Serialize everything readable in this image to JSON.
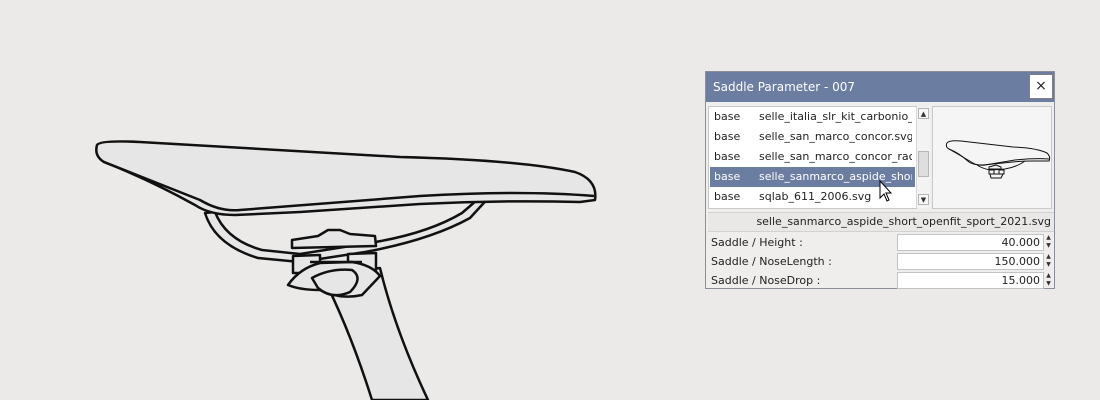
{
  "dialog": {
    "title": "Saddle Parameter - 007",
    "close_glyph": "×",
    "list_rows": [
      {
        "category": "base",
        "file": "selle_italia_slr_kit_carbonio_C"
      },
      {
        "category": "base",
        "file": "selle_san_marco_concor.svg"
      },
      {
        "category": "base",
        "file": "selle_san_marco_concor_raci"
      },
      {
        "category": "base",
        "file": "selle_sanmarco_aspide_short"
      },
      {
        "category": "base",
        "file": "sqlab_611_2006.svg"
      }
    ],
    "selected_row_index": 3,
    "scroll_up_glyph": "▲",
    "scroll_down_glyph": "▼",
    "selected_file": "selle_sanmarco_aspide_short_openfit_sport_2021.svg",
    "params": [
      {
        "label": "Saddle / Height  :",
        "value": "40.000"
      },
      {
        "label": "Saddle / NoseLength  :",
        "value": "150.000"
      },
      {
        "label": "Saddle / NoseDrop  :",
        "value": "15.000"
      }
    ],
    "spin_up_glyph": "▲",
    "spin_down_glyph": "▼"
  },
  "colors": {
    "background": "#ebeae8",
    "titlebar": "#6b7da1",
    "selection": "#6b7da1",
    "drawing_fill": "#e6e6e6",
    "drawing_stroke": "#111111"
  },
  "icons": [
    "close-icon",
    "scroll-up-icon",
    "scroll-down-icon",
    "spin-up-icon",
    "spin-down-icon",
    "mouse-cursor-icon"
  ]
}
